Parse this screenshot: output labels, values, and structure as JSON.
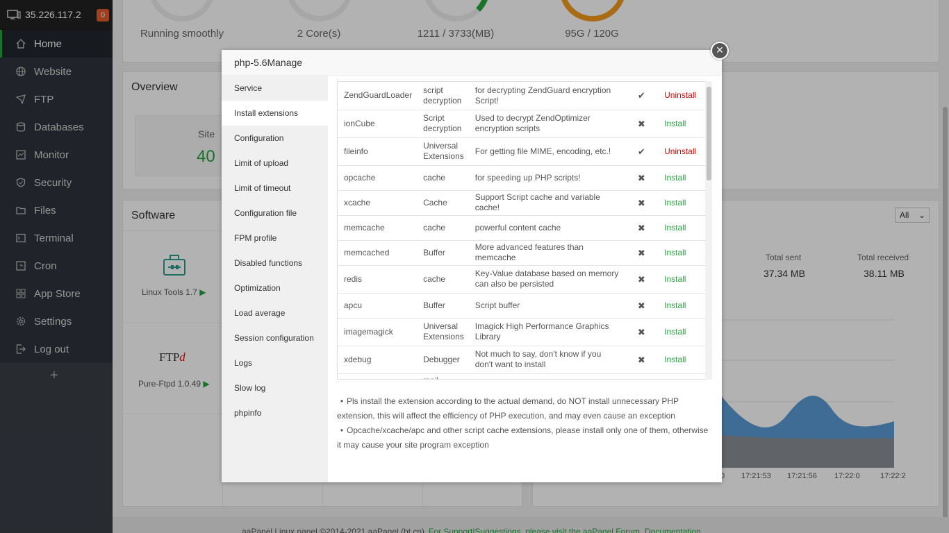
{
  "sidebar": {
    "server_ip": "35.226.117.2",
    "badge_count": "0",
    "items": [
      {
        "label": "Home",
        "icon": "home-icon",
        "active": true
      },
      {
        "label": "Website",
        "icon": "globe-icon"
      },
      {
        "label": "FTP",
        "icon": "ftp-icon"
      },
      {
        "label": "Databases",
        "icon": "database-icon"
      },
      {
        "label": "Monitor",
        "icon": "monitor-icon"
      },
      {
        "label": "Security",
        "icon": "shield-icon"
      },
      {
        "label": "Files",
        "icon": "folder-icon"
      },
      {
        "label": "Terminal",
        "icon": "terminal-icon"
      },
      {
        "label": "Cron",
        "icon": "clock-icon"
      },
      {
        "label": "App Store",
        "icon": "grid-icon"
      },
      {
        "label": "Settings",
        "icon": "gear-icon"
      },
      {
        "label": "Log out",
        "icon": "logout-icon"
      }
    ],
    "add_label": "+"
  },
  "dashboard": {
    "gauges": [
      {
        "label": "Running smoothly",
        "color": "#20a53a"
      },
      {
        "label": "2 Core(s)",
        "color": "#20a53a"
      },
      {
        "label": "1211 / 3733(MB)",
        "color": "#20a53a"
      },
      {
        "label": "95G / 120G",
        "color": "#f29a1d"
      }
    ],
    "overview_title": "Overview",
    "site_label": "Site",
    "site_value": "40",
    "software_title": "Software",
    "software_items": [
      {
        "label": "Linux Tools 1.7",
        "icon": "toolbox-icon"
      },
      {
        "label": "Pure-Ftpd 1.0.49",
        "icon": "ftpd-logo"
      }
    ],
    "ftpd_logo_text": "FTPd",
    "traffic": {
      "filter_value": "All",
      "total_sent_label": "Total sent",
      "total_sent_value": "37.34 MB",
      "total_received_label": "Total received",
      "total_received_value": "38.11 MB",
      "x_ticks": [
        "0",
        "17:21:53",
        "17:21:56",
        "17:22:0",
        "17:22:2"
      ]
    },
    "footer": {
      "copyright": "aaPanel Linux panel ©2014-2021 aaPanel (bt.cn)",
      "support_link": "For Support|Suggestions, please visit the aaPanel Forum",
      "docs_link": "Documentation"
    }
  },
  "modal": {
    "title": "php-5.6Manage",
    "close_label": "×",
    "nav": [
      "Service",
      "Install extensions",
      "Configuration",
      "Limit of upload",
      "Limit of timeout",
      "Configuration file",
      "FPM profile",
      "Disabled functions",
      "Optimization",
      "Load average",
      "Session configuration",
      "Logs",
      "Slow log",
      "phpinfo"
    ],
    "active_nav": "Install extensions",
    "extensions": [
      {
        "name": "ZendGuardLoader",
        "type": "script decryption",
        "desc": "for decrypting ZendGuard encryption Script!",
        "status": "✔",
        "action": "Uninstall"
      },
      {
        "name": "ionCube",
        "type": "Script decryption",
        "desc": "Used to decrypt ZendOptimizer encryption scripts",
        "status": "✖",
        "action": "Install"
      },
      {
        "name": "fileinfo",
        "type": "Universal Extensions",
        "desc": "For getting file MIME, encoding, etc.!",
        "status": "✔",
        "action": "Uninstall"
      },
      {
        "name": "opcache",
        "type": "cache",
        "desc": "for speeding up PHP scripts!",
        "status": "✖",
        "action": "Install"
      },
      {
        "name": "xcache",
        "type": "Cache",
        "desc": "Support Script cache and variable cache!",
        "status": "✖",
        "action": "Install"
      },
      {
        "name": "memcache",
        "type": "cache",
        "desc": "powerful content cache",
        "status": "✖",
        "action": "Install"
      },
      {
        "name": "memcached",
        "type": "Buffer",
        "desc": "More advanced features than memcache",
        "status": "✖",
        "action": "Install"
      },
      {
        "name": "redis",
        "type": "cache",
        "desc": "Key-Value database based on memory can also be persisted",
        "status": "✖",
        "action": "Install"
      },
      {
        "name": "apcu",
        "type": "Buffer",
        "desc": "Script buffer",
        "status": "✖",
        "action": "Install"
      },
      {
        "name": "imagemagick",
        "type": "Universal Extensions",
        "desc": "Imagick High Performance Graphics Library",
        "status": "✖",
        "action": "Install"
      },
      {
        "name": "xdebug",
        "type": "Debugger",
        "desc": "Not much to say, don't know if you don't want to install",
        "status": "✖",
        "action": "Install"
      },
      {
        "name": "",
        "type": "mail",
        "desc": "",
        "status": "",
        "action": ""
      }
    ],
    "notes": [
      "Pls install the extension according to the actual demand, do NOT install unnecessary PHP extension, this will affect the efficiency of PHP execution, and may even cause an exception",
      "Opcache/xcache/apc and other script cache extensions, please install only one of them, otherwise it may cause your site program exception"
    ]
  }
}
